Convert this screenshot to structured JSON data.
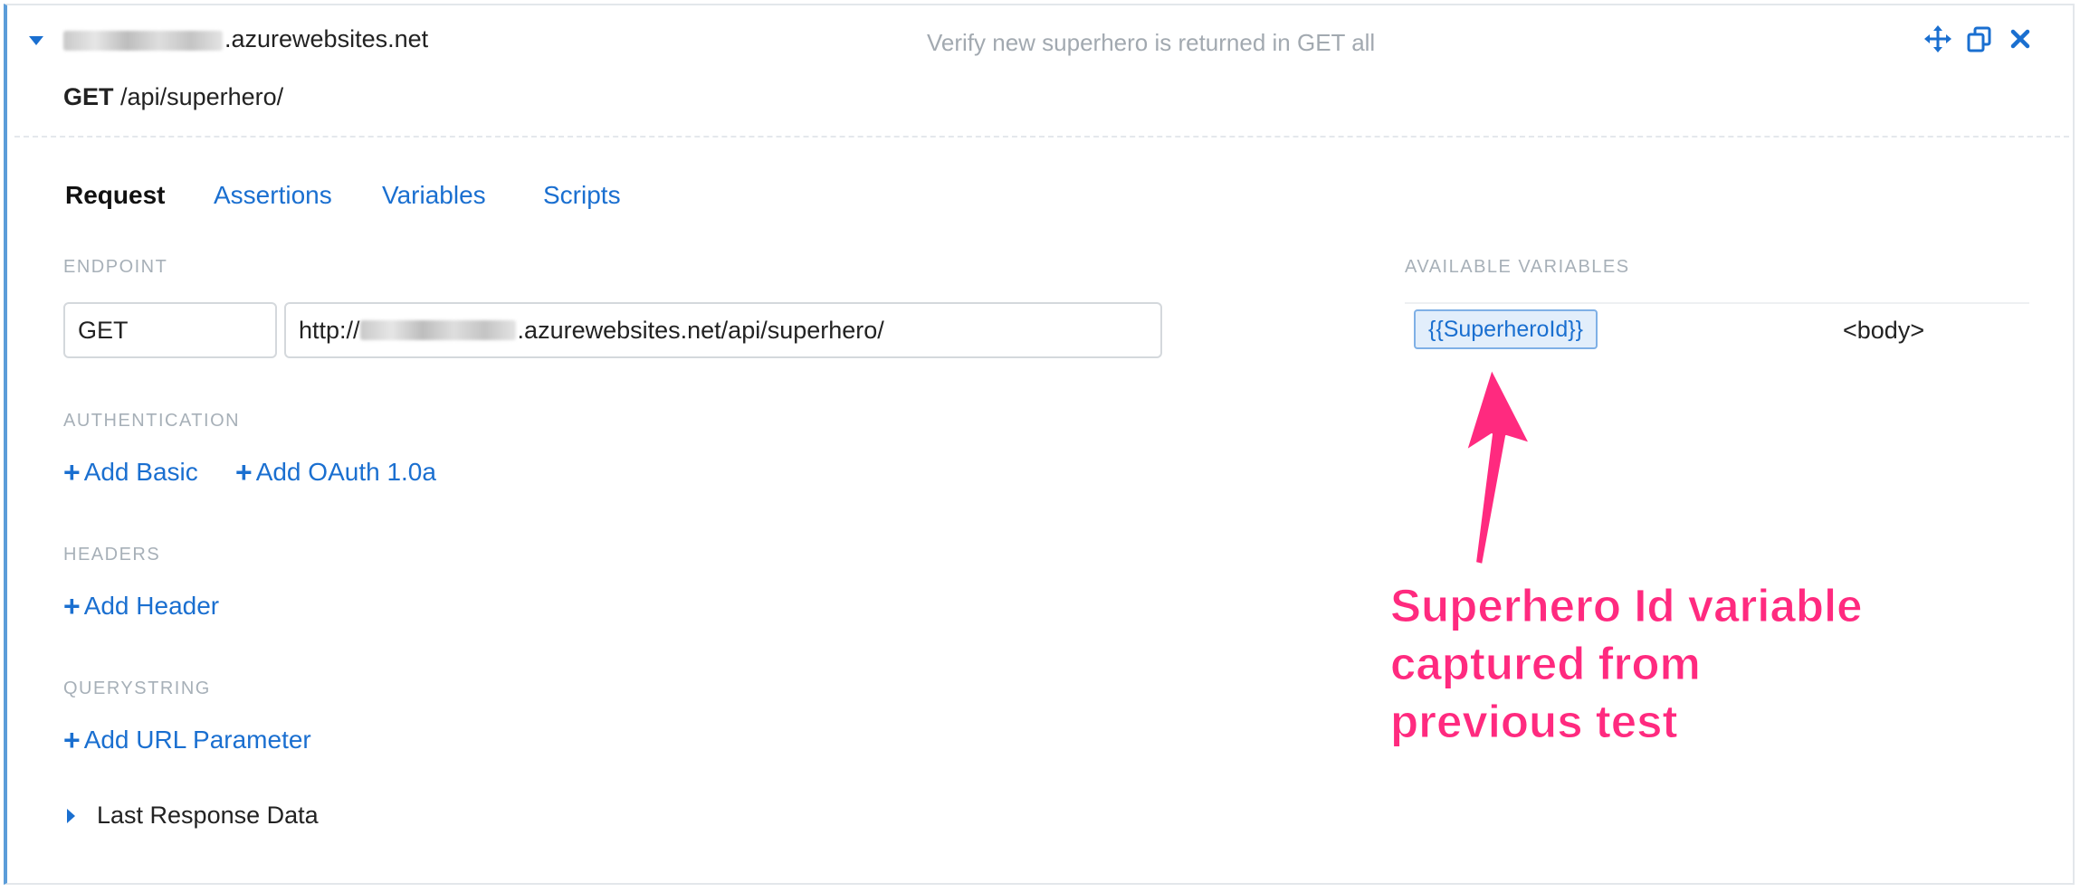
{
  "header": {
    "host_suffix": ".azurewebsites.net",
    "description": "Verify new superhero is returned in GET all",
    "method": "GET",
    "path": "/api/superhero/"
  },
  "tabs": [
    {
      "label": "Request",
      "active": true
    },
    {
      "label": "Assertions",
      "active": false
    },
    {
      "label": "Variables",
      "active": false
    },
    {
      "label": "Scripts",
      "active": false
    }
  ],
  "endpoint": {
    "label": "ENDPOINT",
    "method_value": "GET",
    "url_prefix": "http://",
    "url_suffix": ".azurewebsites.net/api/superhero/"
  },
  "authentication": {
    "label": "AUTHENTICATION",
    "add_basic": "Add Basic",
    "add_oauth": "Add OAuth 1.0a"
  },
  "headers": {
    "label": "HEADERS",
    "add_header": "Add Header"
  },
  "querystring": {
    "label": "QUERYSTRING",
    "add_param": "Add URL Parameter"
  },
  "last_response": {
    "label": "Last Response Data"
  },
  "available_variables": {
    "label": "AVAILABLE VARIABLES",
    "variable": "{{SuperheroId}}",
    "source": "<body>"
  },
  "annotation": {
    "line1": "Superhero Id variable",
    "line2": "captured from",
    "line3": "previous test",
    "color": "#ff2a7f"
  },
  "colors": {
    "link_blue": "#1a6fd0",
    "accent_border": "#5b9dd9",
    "muted_label": "#a7b0b8"
  }
}
